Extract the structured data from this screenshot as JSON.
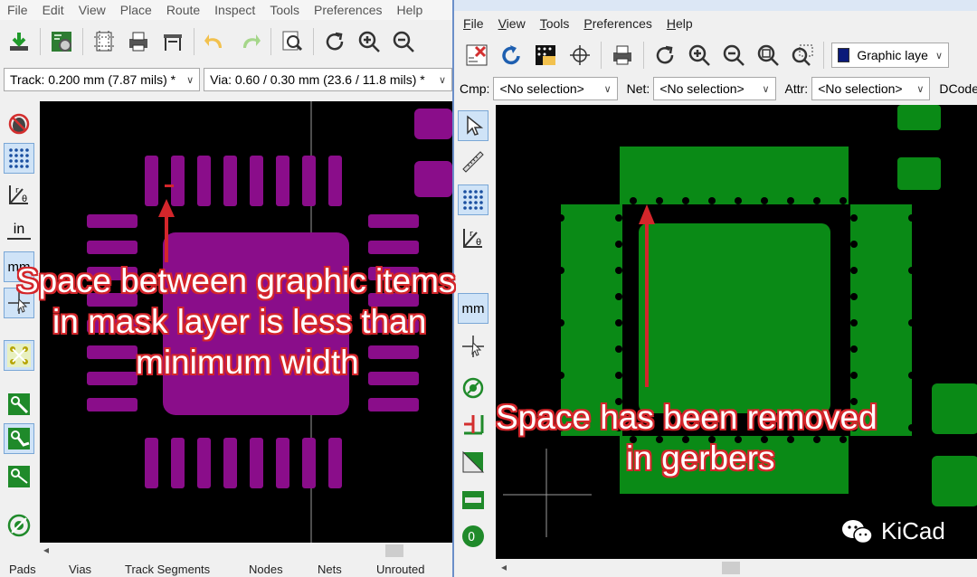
{
  "left_window": {
    "menu": [
      "File",
      "Edit",
      "View",
      "Place",
      "Route",
      "Inspect",
      "Tools",
      "Preferences",
      "Help"
    ],
    "track_combo": "Track: 0.200 mm (7.87 mils) *",
    "via_combo": "Via: 0.60 / 0.30 mm (23.6 / 11.8 mils) *",
    "status_tabs": [
      "Pads",
      "Vias",
      "Track Segments",
      "Nodes",
      "Nets",
      "Unrouted"
    ],
    "vtool_labels": {
      "units_in": "in",
      "units_mm": "mm"
    }
  },
  "right_window": {
    "menu": [
      {
        "label": "File",
        "accel": "F",
        "rest": "ile"
      },
      {
        "label": "View",
        "accel": "V",
        "rest": "iew"
      },
      {
        "label": "Tools",
        "accel": "T",
        "rest": "ools"
      },
      {
        "label": "Preferences",
        "accel": "P",
        "rest": "references"
      },
      {
        "label": "Help",
        "accel": "H",
        "rest": "elp"
      }
    ],
    "layer_combo": "Graphic laye",
    "cmp_label": "Cmp:",
    "cmp_value": "<No selection>",
    "net_label": "Net:",
    "net_value": "<No selection>",
    "attr_label": "Attr:",
    "attr_value": "<No selection>",
    "dcode_label": "DCode",
    "vtool_labels": {
      "units_mm": "mm"
    }
  },
  "annotations": {
    "left_line1": "Space between graphic items",
    "left_line2": "in mask layer is less than",
    "left_line3": "minimum width",
    "right_line1": "Space has been removed",
    "right_line2": "in gerbers"
  },
  "watermark": "KiCad",
  "colors": {
    "mask_purple": "#8a0d8a",
    "gerber_green": "#0a8a16",
    "annotation_red": "#d4262b",
    "canvas_bg": "#000000"
  }
}
